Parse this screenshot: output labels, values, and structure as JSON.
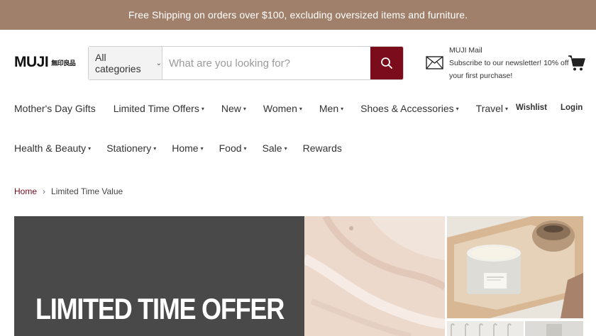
{
  "promo": {
    "text": "Free Shipping on orders over $100, excluding oversized items and furniture."
  },
  "logo": {
    "main": "MUJI",
    "kanji": "無印良品"
  },
  "search": {
    "category_label": "All categories",
    "placeholder": "What are you looking for?"
  },
  "newsletter": {
    "title": "MUJI Mail",
    "line1": "Subscribe to our newsletter! 10% off",
    "line2": "your first purchase!"
  },
  "nav": {
    "row1": [
      {
        "label": "Mother's Day Gifts"
      },
      {
        "label": "Limited Time Offers"
      },
      {
        "label": "New"
      },
      {
        "label": "Women"
      },
      {
        "label": "Men"
      },
      {
        "label": "Shoes & Accessories"
      },
      {
        "label": "Travel"
      }
    ],
    "row2": [
      {
        "label": "Health & Beauty"
      },
      {
        "label": "Stationery"
      },
      {
        "label": "Home"
      },
      {
        "label": "Food"
      },
      {
        "label": "Sale"
      },
      {
        "label": "Rewards"
      }
    ],
    "wishlist": "Wishlist",
    "login": "Login"
  },
  "breadcrumb": {
    "home": "Home",
    "current": "Limited Time Value"
  },
  "hero": {
    "title": "LIMITED TIME OFFER"
  },
  "colors": {
    "promo_bar": "#a0806a",
    "accent": "#7b0c1c",
    "hero_dark": "#494949"
  },
  "icons": [
    "chevron-down-icon",
    "search-icon",
    "mail-icon",
    "cart-icon",
    "chevron-right-icon"
  ]
}
